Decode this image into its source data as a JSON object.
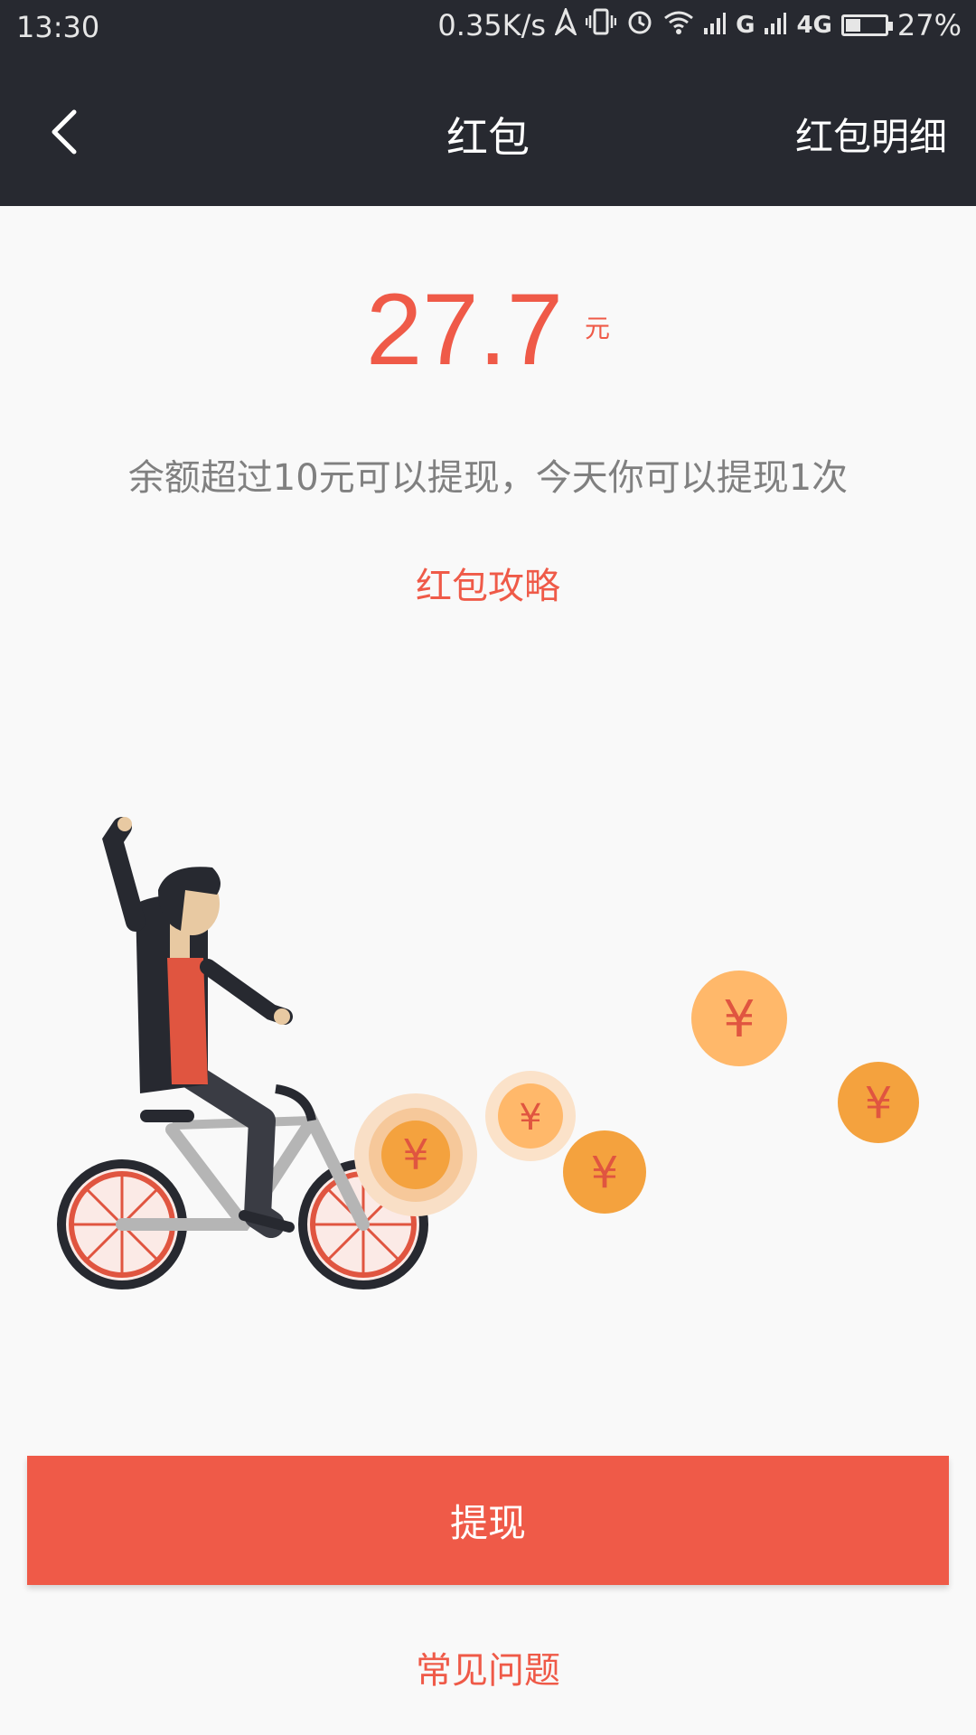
{
  "status_bar": {
    "time": "13:30",
    "net_speed": "0.35K/s",
    "signal_g": "G",
    "signal_4g": "4G",
    "battery": "27%"
  },
  "nav": {
    "title": "红包",
    "right_label": "红包明细",
    "back_icon": "chevron-left-icon"
  },
  "balance": {
    "amount": "27.7",
    "unit": "元"
  },
  "description": "余额超过10元可以提现，今天你可以提现1次",
  "guide_link": "红包攻略",
  "coin_symbol": "¥",
  "actions": {
    "withdraw": "提现",
    "faq": "常见问题"
  },
  "colors": {
    "accent": "#ef5a48",
    "header": "#272930",
    "coin": "#f4a23e",
    "coin_light": "#ffb86a"
  }
}
